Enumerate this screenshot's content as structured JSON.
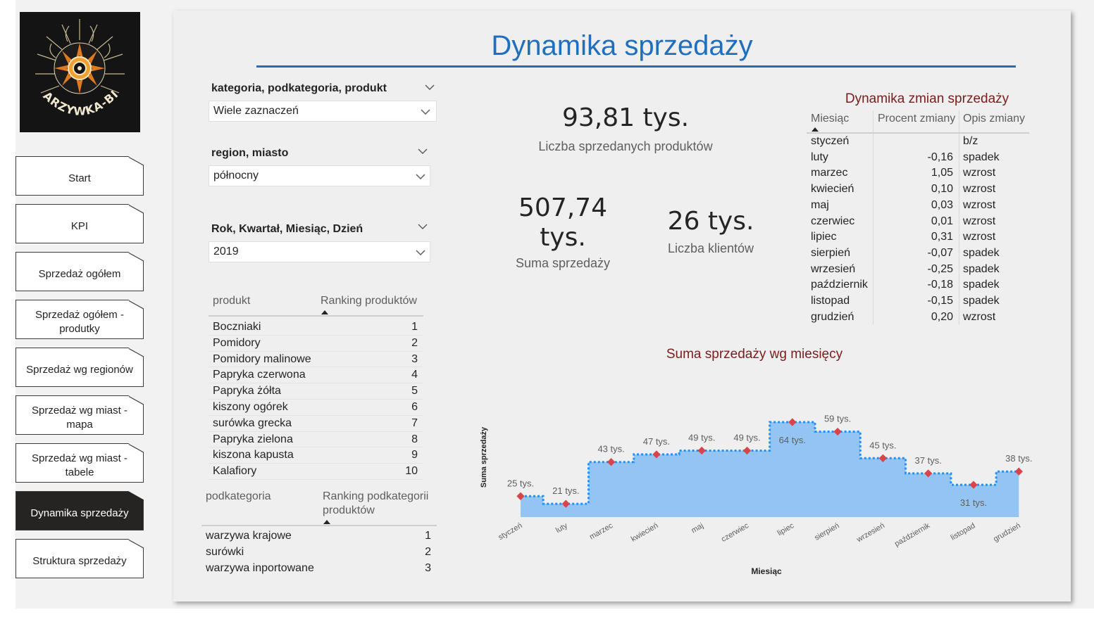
{
  "nav": {
    "items": [
      {
        "label": "Start",
        "active": false
      },
      {
        "label": "KPI",
        "active": false
      },
      {
        "label": "Sprzedaż ogółem",
        "active": false
      },
      {
        "label": "Sprzedaż ogółem - produtky",
        "active": false
      },
      {
        "label": "Sprzedaż wg regionów",
        "active": false
      },
      {
        "label": "Sprzedaż wg miast - mapa",
        "active": false
      },
      {
        "label": "Sprzedaż wg miast - tabele",
        "active": false
      },
      {
        "label": "Dynamika sprzedaży",
        "active": true
      },
      {
        "label": "Struktura sprzedaży",
        "active": false
      }
    ]
  },
  "logo": {
    "text": "WARZYWKA-BIO"
  },
  "page": {
    "title": "Dynamika sprzedaży"
  },
  "slicers": {
    "category": {
      "label": "kategoria, podkategoria, produkt",
      "value": "Wiele zaznaczeń"
    },
    "region": {
      "label": "region, miasto",
      "value": "północny"
    },
    "date": {
      "label": "Rok, Kwartał, Miesiąc, Dzień",
      "value": "2019"
    }
  },
  "kpis": {
    "products_sold": {
      "value": "93,81 tys.",
      "label": "Liczba sprzedanych produktów"
    },
    "sales_sum": {
      "value_line1": "507,74",
      "value_line2": "tys.",
      "label": "Suma sprzedaży"
    },
    "clients": {
      "value": "26 tys.",
      "label": "Liczba klientów"
    }
  },
  "product_ranking": {
    "headers": {
      "product": "produkt",
      "rank": "Ranking produktów"
    },
    "rows": [
      {
        "name": "Boczniaki",
        "rank": "1"
      },
      {
        "name": "Pomidory",
        "rank": "2"
      },
      {
        "name": "Pomidory malinowe",
        "rank": "3"
      },
      {
        "name": "Papryka czerwona",
        "rank": "4"
      },
      {
        "name": "Papryka żółta",
        "rank": "5"
      },
      {
        "name": "kiszony ogórek",
        "rank": "6"
      },
      {
        "name": "surówka grecka",
        "rank": "7"
      },
      {
        "name": "Papryka zielona",
        "rank": "8"
      },
      {
        "name": "kiszona kapusta",
        "rank": "9"
      },
      {
        "name": "Kalafiory",
        "rank": "10"
      }
    ]
  },
  "subcategory_ranking": {
    "headers": {
      "subcategory": "podkategoria",
      "rank_line1": "Ranking podkategorii",
      "rank_line2": "produktów"
    },
    "rows": [
      {
        "name": "warzywa krajowe",
        "rank": "1"
      },
      {
        "name": "surówki",
        "rank": "2"
      },
      {
        "name": "warzywa inportowane",
        "rank": "3"
      }
    ]
  },
  "change_table": {
    "title": "Dynamika zmian sprzedaży",
    "headers": {
      "month": "Miesiąc",
      "pct": "Procent zmiany",
      "desc": "Opis zmiany"
    },
    "rows": [
      {
        "month": "styczeń",
        "pct": "",
        "desc": "b/z"
      },
      {
        "month": "luty",
        "pct": "-0,16",
        "desc": "spadek"
      },
      {
        "month": "marzec",
        "pct": "1,05",
        "desc": "wzrost"
      },
      {
        "month": "kwiecień",
        "pct": "0,10",
        "desc": "wzrost"
      },
      {
        "month": "maj",
        "pct": "0,03",
        "desc": "wzrost"
      },
      {
        "month": "czerwiec",
        "pct": "0,01",
        "desc": "wzrost"
      },
      {
        "month": "lipiec",
        "pct": "0,31",
        "desc": "wzrost"
      },
      {
        "month": "sierpień",
        "pct": "-0,07",
        "desc": "spadek"
      },
      {
        "month": "wrzesień",
        "pct": "-0,25",
        "desc": "spadek"
      },
      {
        "month": "październik",
        "pct": "-0,18",
        "desc": "spadek"
      },
      {
        "month": "listopad",
        "pct": "-0,15",
        "desc": "spadek"
      },
      {
        "month": "grudzień",
        "pct": "0,20",
        "desc": "wzrost"
      }
    ]
  },
  "colors": {
    "accent": "#1f6fbf",
    "area": "#94c5f2",
    "line": "#1e90ff",
    "marker": "#d9434a",
    "title_dark_red": "#7b1c1c"
  },
  "chart_data": {
    "type": "area",
    "step": true,
    "title": "Suma sprzedaży wg miesięcy",
    "xlabel": "Miesiąc",
    "ylabel": "Suma sprzedaży",
    "categories": [
      "styczeń",
      "luty",
      "marzec",
      "kwiecień",
      "maj",
      "czerwiec",
      "lipiec",
      "sierpień",
      "wrzesień",
      "październik",
      "listopad",
      "grudzień"
    ],
    "values": [
      25,
      21,
      43,
      47,
      49,
      49,
      64,
      59,
      45,
      37,
      31,
      38
    ],
    "labels": [
      "25 tys.",
      "21 tys.",
      "43 tys.",
      "47 tys.",
      "49 tys.",
      "49 tys.",
      "64 tys.",
      "59 tys.",
      "45 tys.",
      "37 tys.",
      "31 tys.",
      "38 tys."
    ],
    "label_inside": [
      false,
      false,
      false,
      false,
      false,
      false,
      true,
      false,
      false,
      false,
      true,
      false
    ],
    "grid": false,
    "legend": "none"
  }
}
